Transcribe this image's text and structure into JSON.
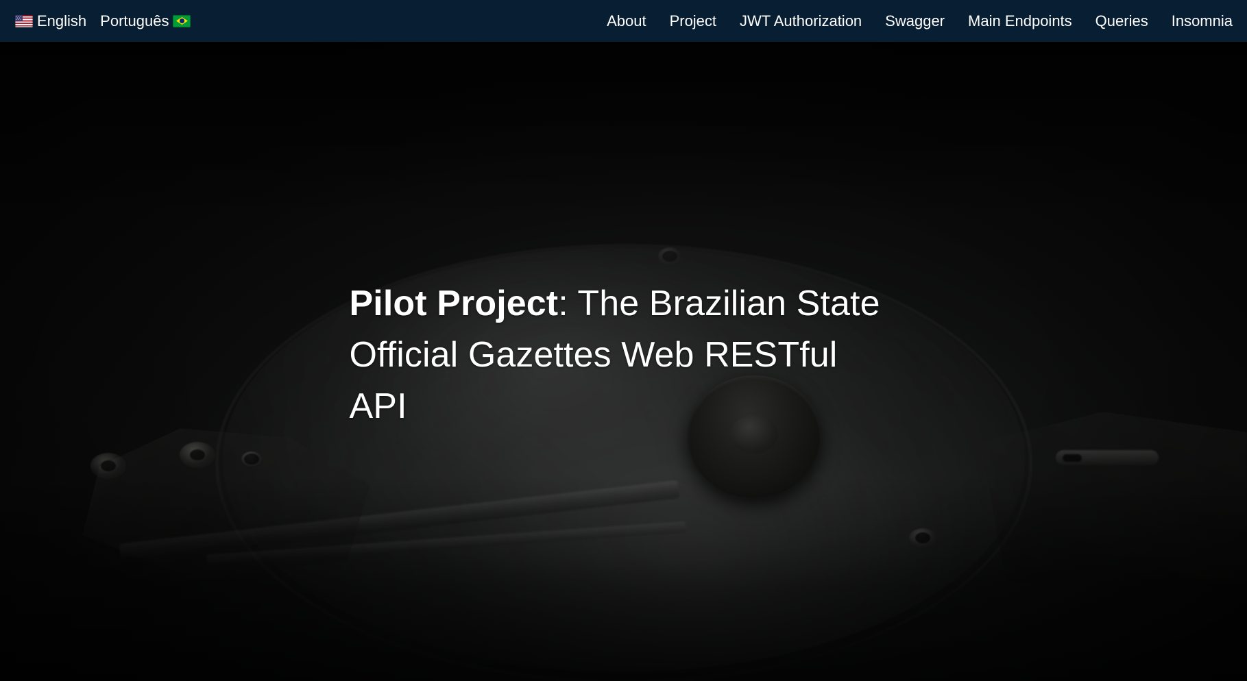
{
  "navbar": {
    "background_color": "#081e33",
    "text_color": "#ffffff",
    "languages": [
      {
        "id": "english",
        "label": "English",
        "flag_icon": "us-flag-icon",
        "flag_emoji": "🇺🇸",
        "flag_position": "before"
      },
      {
        "id": "portuguese",
        "label": "Português",
        "flag_icon": "br-flag-icon",
        "flag_emoji": "🇧🇷",
        "flag_position": "after"
      }
    ],
    "links": [
      {
        "id": "about",
        "label": "About"
      },
      {
        "id": "project",
        "label": "Project"
      },
      {
        "id": "jwt-authorization",
        "label": "JWT Authorization"
      },
      {
        "id": "swagger",
        "label": "Swagger"
      },
      {
        "id": "main-endpoints",
        "label": "Main Endpoints"
      },
      {
        "id": "queries",
        "label": "Queries"
      },
      {
        "id": "insomnia",
        "label": "Insomnia"
      }
    ]
  },
  "hero": {
    "title_strong": "Pilot Project",
    "title_rest": ": The Brazilian State Official Gazettes Web RESTful API",
    "background_image_description": "dark photograph of an opened hard disk drive showing platter, spindle hub and actuator arm",
    "background_base_color": "#0b0c0c",
    "title_color": "#ffffff"
  }
}
